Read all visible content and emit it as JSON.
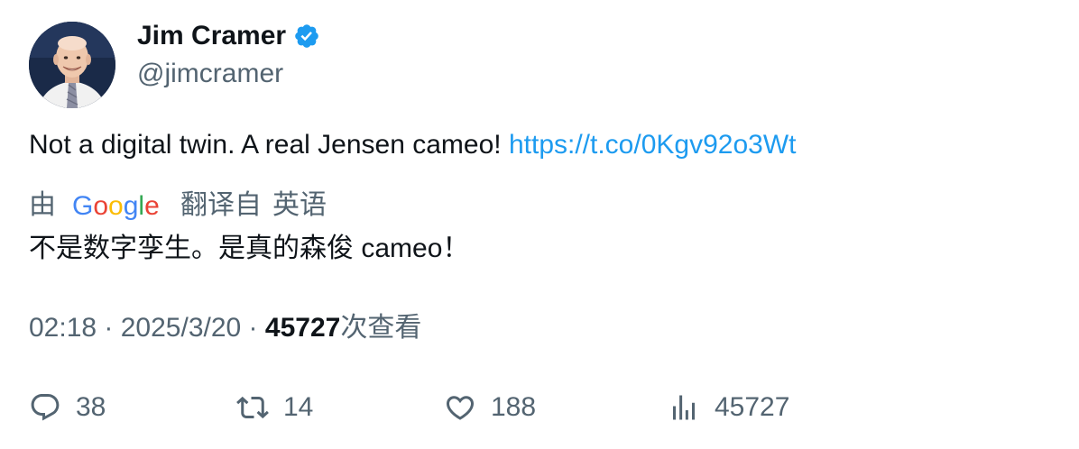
{
  "author": {
    "name": "Jim Cramer",
    "handle": "@jimcramer",
    "verified": true
  },
  "tweet": {
    "text": "Not a digital twin. A real Jensen cameo! ",
    "link": "https://t.co/0Kgv92o3Wt"
  },
  "translation": {
    "by_label": "由",
    "provider": "Google",
    "from_label": "翻译自",
    "language": "英语",
    "text": "不是数字孪生。是真的森俊 cameo！"
  },
  "meta": {
    "time": "02:18",
    "separator": " · ",
    "date": "2025/3/20",
    "views_count": "45727",
    "views_label": "次查看"
  },
  "actions": {
    "replies": "38",
    "retweets": "14",
    "likes": "188",
    "views": "45727"
  },
  "colors": {
    "link": "#1d9bf0",
    "secondary_text": "#536471",
    "primary_text": "#0f1419",
    "verified": "#1d9bf0"
  }
}
